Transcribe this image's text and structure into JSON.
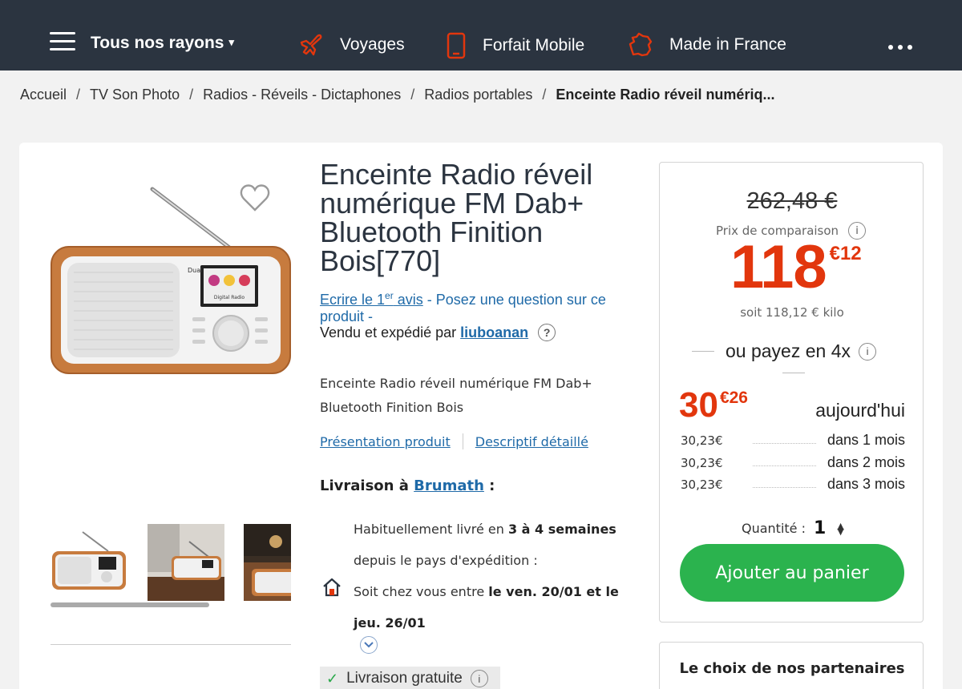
{
  "header": {
    "menu_label": "Tous nos rayons",
    "caret": "▾",
    "nav": [
      {
        "label": "Voyages",
        "icon": "plane-icon"
      },
      {
        "label": "Forfait Mobile",
        "icon": "mobile-phone-icon"
      },
      {
        "label": "Made in France",
        "icon": "france-map-icon"
      }
    ],
    "more_icon": "more-dots-icon",
    "colors": {
      "bar": "#2b3440",
      "icon_accent": "#e2360d"
    }
  },
  "breadcrumb": {
    "items": [
      "Accueil",
      "TV Son Photo",
      "Radios - Réveils - Dictaphones",
      "Radios portables"
    ],
    "current": "Enceinte Radio réveil numériq...",
    "separator": "/"
  },
  "product": {
    "title": "Enceinte Radio réveil numérique FM Dab+ Bluetooth Finition Bois[770]",
    "review_link_pre": "Ecrire le 1",
    "review_link_sup": "er",
    "review_link_post": " avis",
    "question_link": " - Posez une question sur ce produit -",
    "seller_label": "Vendu et expédié par",
    "seller_name": "liuboanan",
    "seller_help": "?",
    "description": "Enceinte Radio réveil numérique FM Dab+ Bluetooth Finition Bois",
    "tab_presentation": "Présentation produit",
    "tab_details": "Descriptif détaillé",
    "radio_screen_text": "Digital Radio",
    "radio_brand": "Dual"
  },
  "delivery": {
    "title_prefix": "Livraison à",
    "city": "Brumath",
    "title_suffix": " :",
    "line1_pre": "Habituellement livré en ",
    "line1_bold": "3 à 4 semaines",
    "line2": "depuis le pays d'expédition :",
    "line3_pre": "Soit chez vous entre ",
    "line3_bold": "le ven. 20/01 et le jeu. 26/01",
    "free_shipping": "Livraison gratuite",
    "info": "i"
  },
  "price": {
    "old_price": "262,48 €",
    "compare_label": "Prix de comparaison",
    "info": "i",
    "int": "118",
    "cents": "€12",
    "per_kilo": "soit 118,12 € kilo",
    "pay4_label": "ou payez en 4x",
    "today_int": "30",
    "today_cents": "€26",
    "today_label": "aujourd'hui",
    "installments": [
      {
        "amount": "30,23€",
        "when": "dans 1 mois"
      },
      {
        "amount": "30,23€",
        "when": "dans 2 mois"
      },
      {
        "amount": "30,23€",
        "when": "dans 3 mois"
      }
    ],
    "quantity_label": "Quantité :",
    "quantity_value": "1",
    "add_to_cart": "Ajouter au panier",
    "accent": "#e2360d",
    "cta_color": "#2bb34e"
  },
  "partners": {
    "title": "Le choix de nos partenaires"
  }
}
